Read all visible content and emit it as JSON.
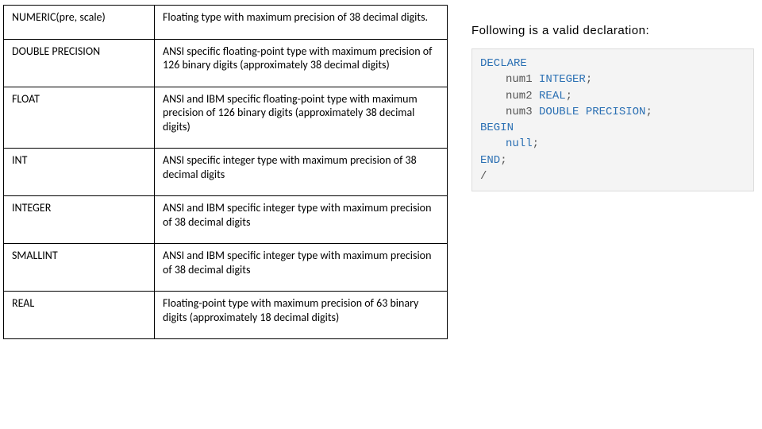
{
  "table": {
    "rows": [
      {
        "type": "NUMERIC(pre, scale)",
        "desc": "Floating type with maximum precision of 38 decimal digits."
      },
      {
        "type": "DOUBLE PRECISION",
        "desc": "ANSI specific floating-point type with maximum precision of 126 binary digits (approximately 38 decimal digits)"
      },
      {
        "type": "FLOAT",
        "desc": "ANSI and IBM specific floating-point type with maximum precision of 126 binary digits (approximately 38 decimal digits)"
      },
      {
        "type": "INT",
        "desc": "ANSI specific integer type with maximum precision of 38 decimal digits"
      },
      {
        "type": "INTEGER",
        "desc": "ANSI and IBM specific integer type with maximum precision of 38 decimal digits"
      },
      {
        "type": "SMALLINT",
        "desc": "ANSI and IBM specific integer type with maximum precision of 38 decimal digits"
      },
      {
        "type": "REAL",
        "desc": "Floating-point type with maximum precision of 63 binary digits (approximately 18 decimal digits)"
      }
    ]
  },
  "right": {
    "heading": "Following is a valid declaration:",
    "code": {
      "declare": "DECLARE",
      "line1_var": "num1",
      "line1_type": "INTEGER",
      "line2_var": "num2",
      "line2_type": "REAL",
      "line3_var": "num3",
      "line3_type": "DOUBLE PRECISION",
      "begin": "BEGIN",
      "nullkw": "null",
      "end": "END",
      "slash": "/",
      "semicolon": ";"
    }
  }
}
